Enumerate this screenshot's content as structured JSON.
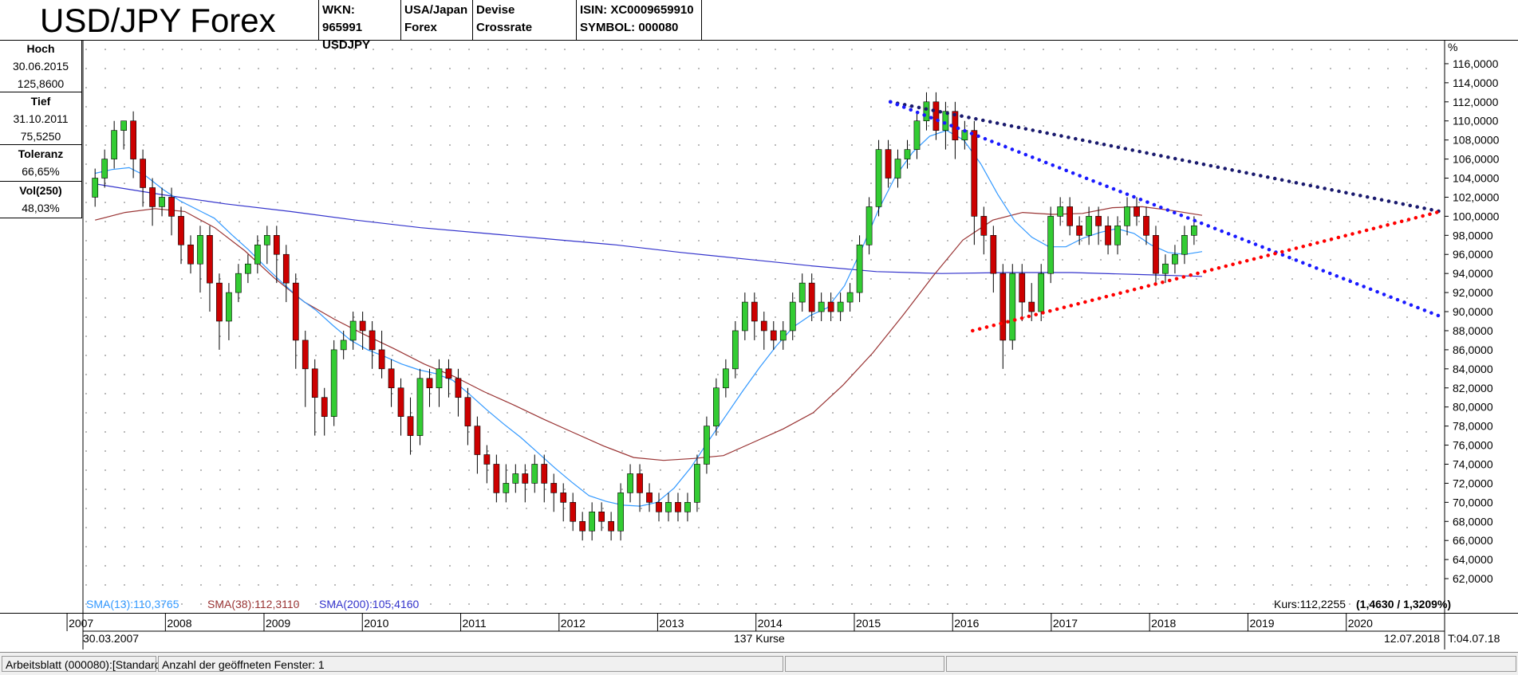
{
  "header": {
    "title": "USD/JPY Forex",
    "wkn": "WKN: 965991",
    "symbol_short": "USDJPY",
    "region_line1": "USA/Japan",
    "region_line2": "Forex",
    "type": "Devise Crossrate",
    "isin": "ISIN: XC0009659910",
    "symbol": "SYMBOL: 000080"
  },
  "stats": {
    "hoch_label": "Hoch",
    "hoch_date": "30.06.2015",
    "hoch_value": "125,8600",
    "tief_label": "Tief",
    "tief_date": "31.10.2011",
    "tief_value": "75,5250",
    "toleranz_label": "Toleranz",
    "toleranz_value": "66,65%",
    "vol_label": "Vol(250)",
    "vol_value": "48,03%"
  },
  "legend": {
    "sma13": "SMA(13):110,3765",
    "sma38": "SMA(38):112,3110",
    "sma200": "SMA(200):105,4160",
    "kurs_prefix": "Kurs:112,2255",
    "kurs_change": "(1,4630 / 1,3209%)"
  },
  "footer": {
    "start_date": "30.03.2007",
    "count": "137 Kurse",
    "end_date": "12.07.2018",
    "t_label": "T:04.07.18"
  },
  "statusbar": {
    "sheet": "Arbeitsblatt (000080):[Standard]",
    "windows": "Anzahl der geöffneten Fenster: 1"
  },
  "colors": {
    "bull": "#33cc33",
    "bear": "#cc0000",
    "sma13": "#3399ff",
    "sma38": "#993333",
    "sma200": "#3333cc",
    "trend_dark": "#1a1a6e",
    "trend_blue": "#1a1aff",
    "trend_red": "#ff0000"
  },
  "chart_data": {
    "type": "candlestick",
    "title": "USD/JPY Forex",
    "y_unit_label": "%",
    "ylim": [
      60,
      118
    ],
    "y_ticks": [
      "62,0000",
      "64,0000",
      "66,0000",
      "68,0000",
      "70,0000",
      "72,0000",
      "74,0000",
      "76,0000",
      "78,0000",
      "80,0000",
      "82,0000",
      "84,0000",
      "86,0000",
      "88,0000",
      "90,0000",
      "92,0000",
      "94,0000",
      "96,0000",
      "98,0000",
      "100,0000",
      "102,0000",
      "104,0000",
      "106,0000",
      "108,0000",
      "110,0000",
      "112,0000",
      "114,0000",
      "116,0000"
    ],
    "x_years": [
      "2007",
      "2008",
      "2009",
      "2010",
      "2011",
      "2012",
      "2013",
      "2014",
      "2015",
      "2016",
      "2017",
      "2018",
      "2019",
      "2020"
    ],
    "x_range": [
      "2007-03-01",
      "2020-12-31"
    ],
    "grid": true,
    "candles": [
      [
        "2007-04",
        102,
        104,
        101,
        105
      ],
      [
        "2007-05",
        104,
        106,
        103,
        107
      ],
      [
        "2007-06",
        106,
        109,
        105,
        110
      ],
      [
        "2007-07",
        109,
        110,
        107,
        110
      ],
      [
        "2007-08",
        110,
        106,
        104,
        111
      ],
      [
        "2007-09",
        106,
        103,
        101,
        107
      ],
      [
        "2007-10",
        103,
        101,
        99,
        104
      ],
      [
        "2007-11",
        101,
        102,
        100,
        103
      ],
      [
        "2007-12",
        102,
        100,
        98,
        103
      ],
      [
        "2008-01",
        100,
        97,
        95,
        101
      ],
      [
        "2008-02",
        97,
        95,
        94,
        98
      ],
      [
        "2008-03",
        95,
        98,
        92,
        99
      ],
      [
        "2008-04",
        98,
        93,
        90,
        99
      ],
      [
        "2008-05",
        93,
        89,
        86,
        94
      ],
      [
        "2008-06",
        89,
        92,
        87,
        93
      ],
      [
        "2008-07",
        92,
        94,
        91,
        95
      ],
      [
        "2008-08",
        94,
        95,
        93,
        96
      ],
      [
        "2008-09",
        95,
        97,
        94,
        98
      ],
      [
        "2008-10",
        97,
        98,
        95,
        99
      ],
      [
        "2008-11",
        98,
        96,
        93,
        99
      ],
      [
        "2008-12",
        96,
        93,
        91,
        97
      ],
      [
        "2009-01",
        93,
        87,
        84,
        94
      ],
      [
        "2009-02",
        87,
        84,
        80,
        88
      ],
      [
        "2009-03",
        84,
        81,
        77,
        85
      ],
      [
        "2009-04",
        81,
        79,
        77,
        82
      ],
      [
        "2009-05",
        79,
        86,
        78,
        87
      ],
      [
        "2009-06",
        86,
        87,
        85,
        88
      ],
      [
        "2009-07",
        87,
        89,
        86,
        90
      ],
      [
        "2009-08",
        89,
        88,
        86,
        90
      ],
      [
        "2009-09",
        88,
        86,
        84,
        89
      ],
      [
        "2009-10",
        86,
        84,
        83,
        88
      ],
      [
        "2009-11",
        84,
        82,
        80,
        85
      ],
      [
        "2009-12",
        82,
        79,
        77,
        83
      ],
      [
        "2010-01",
        79,
        77,
        75,
        81
      ],
      [
        "2010-02",
        77,
        83,
        76,
        84
      ],
      [
        "2010-03",
        83,
        82,
        80,
        84
      ],
      [
        "2010-04",
        82,
        84,
        80,
        85
      ],
      [
        "2010-05",
        84,
        83,
        81,
        85
      ],
      [
        "2010-06",
        83,
        81,
        79,
        84
      ],
      [
        "2010-07",
        81,
        78,
        76,
        82
      ],
      [
        "2010-08",
        78,
        75,
        73,
        79
      ],
      [
        "2010-09",
        75,
        74,
        72,
        76
      ],
      [
        "2010-10",
        74,
        71,
        70,
        75
      ],
      [
        "2010-11",
        71,
        72,
        70,
        74
      ],
      [
        "2010-12",
        72,
        73,
        71,
        74
      ],
      [
        "2011-01",
        73,
        72,
        70,
        74
      ],
      [
        "2011-02",
        72,
        74,
        71,
        75
      ],
      [
        "2011-03",
        74,
        72,
        70,
        75
      ],
      [
        "2011-04",
        72,
        71,
        69,
        73
      ],
      [
        "2011-05",
        71,
        70,
        68,
        72
      ],
      [
        "2011-06",
        70,
        68,
        67,
        71
      ],
      [
        "2011-07",
        68,
        67,
        66,
        69
      ],
      [
        "2011-08",
        67,
        69,
        66,
        70
      ],
      [
        "2011-09",
        69,
        68,
        67,
        70
      ],
      [
        "2011-10",
        68,
        67,
        66,
        69
      ],
      [
        "2011-11",
        67,
        71,
        66,
        72
      ],
      [
        "2011-12",
        71,
        73,
        70,
        74
      ],
      [
        "2012-01",
        73,
        71,
        69,
        74
      ],
      [
        "2012-02",
        71,
        70,
        69,
        72
      ],
      [
        "2012-03",
        70,
        69,
        68,
        71
      ],
      [
        "2012-04",
        69,
        70,
        68,
        71
      ],
      [
        "2012-05",
        70,
        69,
        68,
        71
      ],
      [
        "2012-06",
        69,
        70,
        68,
        71
      ],
      [
        "2012-07",
        70,
        74,
        69,
        75
      ],
      [
        "2012-08",
        74,
        78,
        73,
        79
      ],
      [
        "2012-09",
        78,
        82,
        77,
        83
      ],
      [
        "2012-10",
        82,
        84,
        81,
        85
      ],
      [
        "2012-11",
        84,
        88,
        83,
        89
      ],
      [
        "2012-12",
        88,
        91,
        87,
        92
      ],
      [
        "2013-01",
        91,
        89,
        87,
        92
      ],
      [
        "2013-02",
        89,
        88,
        86,
        90
      ],
      [
        "2013-03",
        88,
        87,
        86,
        89
      ],
      [
        "2013-04",
        87,
        88,
        86,
        89
      ],
      [
        "2013-05",
        88,
        91,
        87,
        92
      ],
      [
        "2013-06",
        91,
        93,
        90,
        94
      ],
      [
        "2013-07",
        93,
        90,
        89,
        94
      ],
      [
        "2013-08",
        90,
        91,
        89,
        92
      ],
      [
        "2013-09",
        91,
        90,
        89,
        92
      ],
      [
        "2013-10",
        90,
        91,
        89,
        92
      ],
      [
        "2013-11",
        91,
        92,
        90,
        93
      ],
      [
        "2013-12",
        92,
        97,
        91,
        98
      ],
      [
        "2014-01",
        97,
        101,
        96,
        102
      ],
      [
        "2014-02",
        101,
        107,
        100,
        108
      ],
      [
        "2014-03",
        107,
        104,
        103,
        108
      ],
      [
        "2014-04",
        104,
        106,
        103,
        107
      ],
      [
        "2014-05",
        106,
        107,
        105,
        108
      ],
      [
        "2014-06",
        107,
        110,
        106,
        111
      ],
      [
        "2014-07",
        110,
        112,
        109,
        113
      ],
      [
        "2014-08",
        112,
        109,
        108,
        113
      ],
      [
        "2014-09",
        109,
        111,
        107,
        112
      ],
      [
        "2014-10",
        111,
        108,
        106,
        112
      ],
      [
        "2014-11",
        108,
        109,
        107,
        110
      ],
      [
        "2014-12",
        109,
        100,
        97,
        110
      ],
      [
        "2015-01",
        100,
        98,
        96,
        101
      ],
      [
        "2015-02",
        98,
        94,
        92,
        99
      ],
      [
        "2015-03",
        94,
        87,
        84,
        95
      ],
      [
        "2015-04",
        87,
        94,
        86,
        95
      ],
      [
        "2015-05",
        94,
        91,
        89,
        95
      ],
      [
        "2015-06",
        91,
        90,
        89,
        93
      ],
      [
        "2015-07",
        90,
        94,
        89,
        95
      ],
      [
        "2015-08",
        94,
        100,
        93,
        101
      ],
      [
        "2015-09",
        100,
        101,
        99,
        102
      ],
      [
        "2015-10",
        101,
        99,
        98,
        102
      ],
      [
        "2015-11",
        99,
        98,
        97,
        100
      ],
      [
        "2015-12",
        98,
        100,
        97,
        101
      ],
      [
        "2016-01",
        100,
        99,
        97,
        101
      ],
      [
        "2016-02",
        99,
        97,
        96,
        100
      ],
      [
        "2016-03",
        97,
        99,
        96,
        100
      ],
      [
        "2016-04",
        99,
        101,
        98,
        102
      ],
      [
        "2016-05",
        101,
        100,
        99,
        102
      ],
      [
        "2016-06",
        100,
        98,
        97,
        101
      ],
      [
        "2016-07",
        98,
        94,
        93,
        99
      ],
      [
        "2016-08",
        94,
        95,
        93,
        96
      ],
      [
        "2016-09",
        95,
        96,
        94,
        97
      ],
      [
        "2016-10",
        96,
        98,
        95,
        99
      ],
      [
        "2016-11",
        98,
        99,
        97,
        100
      ]
    ],
    "sma13": [
      104.5,
      104.9,
      105.1,
      104.2,
      102.8,
      101.6,
      100.7,
      99.8,
      98.1,
      96.5,
      94.7,
      93.0,
      91.4,
      90.1,
      88.5,
      87.0,
      86.0,
      85.3,
      84.5,
      83.9,
      83.5,
      82.8,
      81.3,
      79.7,
      78.2,
      76.8,
      75.2,
      73.6,
      72.1,
      70.7,
      70.1,
      69.7,
      69.6,
      70.0,
      71.5,
      73.7,
      76.4,
      79.0,
      81.6,
      84.1,
      86.4,
      88.4,
      89.6,
      90.4,
      92.7,
      96.5,
      100.7,
      104.2,
      106.7,
      108.4,
      109.0,
      108.0,
      105.5,
      102.3,
      99.5,
      97.8,
      96.8,
      96.8,
      97.7,
      98.3,
      98.7,
      98.2,
      97.0,
      96.2,
      96.0,
      96.3
    ],
    "sma38": [
      99.6,
      100.4,
      100.8,
      100.5,
      98.8,
      96.4,
      93.5,
      91.0,
      89.2,
      87.6,
      86.1,
      84.5,
      83.2,
      81.6,
      80.2,
      78.7,
      77.3,
      75.9,
      74.7,
      74.4,
      74.6,
      74.9,
      76.3,
      77.7,
      79.4,
      82.3,
      85.7,
      89.6,
      93.7,
      97.5,
      99.6,
      100.4,
      100.2,
      100.3,
      100.9,
      101.0,
      100.6,
      100.1
    ],
    "sma200": [
      103.4,
      102.3,
      101.3,
      100.5,
      99.6,
      98.8,
      98.2,
      97.6,
      97.0,
      96.2,
      95.5,
      94.8,
      94.2,
      94.0,
      94.1,
      94.1,
      93.9,
      93.7
    ],
    "trendlines": [
      {
        "name": "upper-outer",
        "from": [
          "2015-05",
          112.0
        ],
        "to": [
          "2020-12",
          100.5
        ]
      },
      {
        "name": "upper-inner",
        "from": [
          "2015-05",
          112.0
        ],
        "to": [
          "2020-12",
          89.5
        ]
      },
      {
        "name": "lower",
        "from": [
          "2016-03",
          88.0
        ],
        "to": [
          "2020-12",
          100.5
        ]
      }
    ]
  }
}
